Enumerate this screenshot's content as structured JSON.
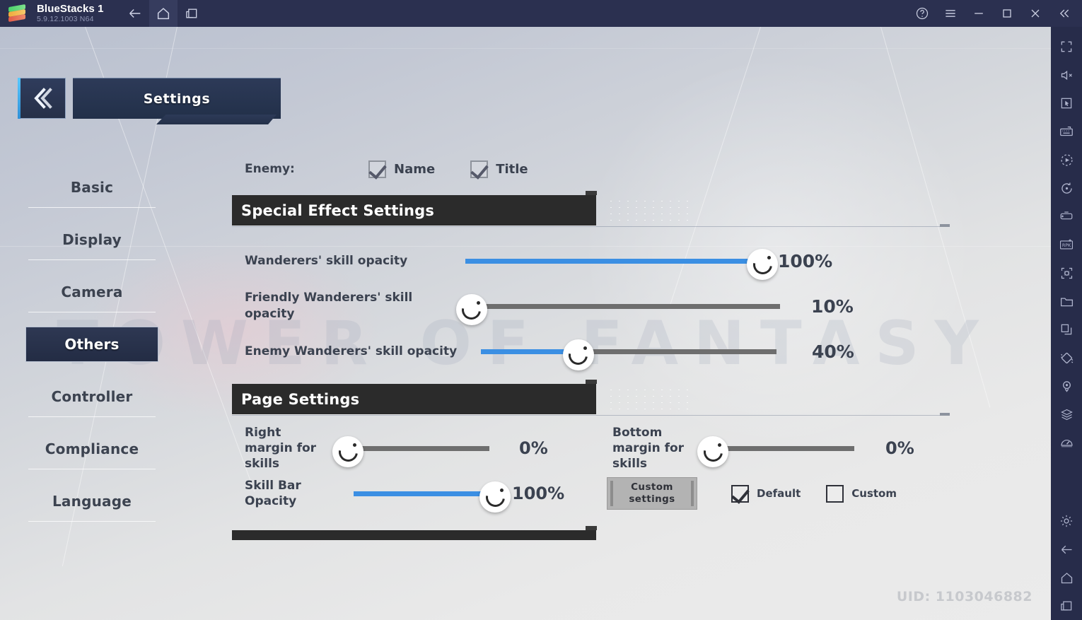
{
  "titlebar": {
    "app_name": "BlueStacks 1",
    "version": "5.9.12.1003  N64",
    "nav": [
      {
        "name": "back-icon",
        "label": "Back"
      },
      {
        "name": "home-icon",
        "label": "Home"
      },
      {
        "name": "recents-icon",
        "label": "Recents"
      }
    ],
    "window_controls": [
      {
        "name": "help-icon",
        "label": "Help"
      },
      {
        "name": "menu-icon",
        "label": "Menu"
      },
      {
        "name": "minimize-icon",
        "label": "Minimize"
      },
      {
        "name": "maximize-icon",
        "label": "Maximize"
      },
      {
        "name": "close-icon",
        "label": "Close"
      },
      {
        "name": "collapse-icon",
        "label": "Collapse sidebar"
      }
    ]
  },
  "rail": {
    "top_items": [
      "fullscreen-icon",
      "mute-volume-icon",
      "cursor-icon",
      "keyboard-icon",
      "macro-play-icon",
      "rotate-icon",
      "gamepad-icon",
      "rpk-icon",
      "screenshot-icon",
      "folder-icon",
      "copy-icon",
      "shake-icon",
      "location-icon",
      "multi-instance-icon",
      "eco-mode-icon"
    ],
    "bottom_items": [
      "settings-gear-icon",
      "android-back-icon",
      "android-home-icon",
      "android-recents-icon"
    ]
  },
  "game": {
    "watermark": "TOWER OF FANTASY",
    "header": {
      "back_label": "Back",
      "title": "Settings"
    },
    "left_nav": [
      {
        "label": "Basic",
        "selected": false
      },
      {
        "label": "Display",
        "selected": false
      },
      {
        "label": "Camera",
        "selected": false
      },
      {
        "label": "Others",
        "selected": true
      },
      {
        "label": "Controller",
        "selected": false
      },
      {
        "label": "Compliance",
        "selected": false
      },
      {
        "label": "Language",
        "selected": false
      }
    ],
    "enemy_row": {
      "label": "Enemy:",
      "options": [
        {
          "label": "Name",
          "checked": true
        },
        {
          "label": "Title",
          "checked": true
        }
      ]
    },
    "special_effect_settings": {
      "title": "Special Effect Settings",
      "sliders": [
        {
          "label": "Wanderers' skill opacity",
          "value": 100,
          "display": "100%",
          "track_width": 420,
          "fill_color": "#3b8fe3"
        },
        {
          "label": "Friendly Wanderers' skill opacity",
          "value": 10,
          "display": "10%",
          "track_width": 445,
          "fill_color": "#3b8fe3"
        },
        {
          "label": "Enemy Wanderers' skill opacity",
          "value": 40,
          "display": "40%",
          "track_width": 418,
          "fill_color": "#3b8fe3"
        }
      ]
    },
    "page_settings": {
      "title": "Page Settings",
      "left_column": [
        {
          "label": "Right margin for skills",
          "value": 0,
          "display": "0%",
          "track_width": 200
        },
        {
          "label": "Skill Bar Opacity",
          "value": 100,
          "display": "100%",
          "track_width": 200
        }
      ],
      "right_column": [
        {
          "label": "Bottom margin for skills",
          "value": 0,
          "display": "0%",
          "track_width": 200
        }
      ],
      "custom_button": "Custom\nsettings",
      "custom_button_line1": "Custom",
      "custom_button_line2": "settings",
      "mode_options": [
        {
          "label": "Default",
          "checked": true
        },
        {
          "label": "Custom",
          "checked": false
        }
      ]
    },
    "uid": "UID: 1103046882"
  }
}
